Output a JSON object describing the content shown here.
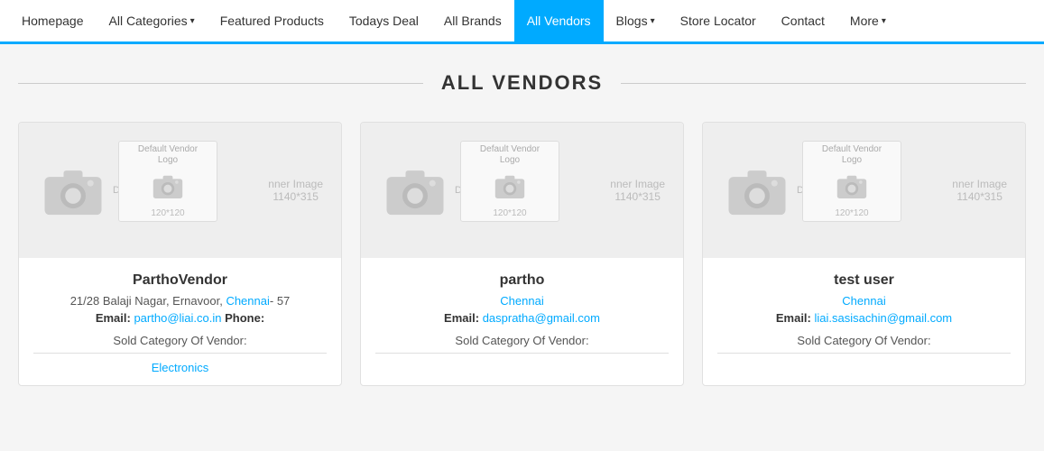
{
  "nav": {
    "items": [
      {
        "label": "Homepage",
        "active": false,
        "hasDropdown": false
      },
      {
        "label": "All Categories",
        "active": false,
        "hasDropdown": true
      },
      {
        "label": "Featured Products",
        "active": false,
        "hasDropdown": false
      },
      {
        "label": "Todays Deal",
        "active": false,
        "hasDropdown": false
      },
      {
        "label": "All Brands",
        "active": false,
        "hasDropdown": false
      },
      {
        "label": "All Vendors",
        "active": true,
        "hasDropdown": false
      },
      {
        "label": "Blogs",
        "active": false,
        "hasDropdown": true
      },
      {
        "label": "Store Locator",
        "active": false,
        "hasDropdown": false
      },
      {
        "label": "Contact",
        "active": false,
        "hasDropdown": false
      },
      {
        "label": "More",
        "active": false,
        "hasDropdown": true
      }
    ]
  },
  "page": {
    "title": "ALL VENDORS"
  },
  "vendors": [
    {
      "name": "ParthoVendor",
      "address": "21/28 Balaji Nagar, Ernavoor, Chennai- 57",
      "address_link": "Chennai",
      "email_label": "Email:",
      "email": "partho@liai.co.in",
      "phone_label": "Phone:",
      "phone": "",
      "sold_category_label": "Sold Category Of Vendor:",
      "sold_category": "Electronics",
      "logo_label": "Default Vendor\nLogo",
      "logo_size": "120*120",
      "banner_text": "nner Image",
      "banner_size": "1140*315"
    },
    {
      "name": "partho",
      "address": "",
      "address_link": "Chennai",
      "email_label": "Email:",
      "email": "daspratha@gmail.com",
      "phone_label": "",
      "phone": "",
      "sold_category_label": "Sold Category Of Vendor:",
      "sold_category": "",
      "logo_label": "Default Vendor\nLogo",
      "logo_size": "120*120",
      "banner_text": "nner Image",
      "banner_size": "1140*315"
    },
    {
      "name": "test user",
      "address": "",
      "address_link": "Chennai",
      "email_label": "Email:",
      "email": "liai.sasisachin@gmail.com",
      "phone_label": "",
      "phone": "",
      "sold_category_label": "Sold Category Of Vendor:",
      "sold_category": "",
      "logo_label": "Default Vendor\nLogo",
      "logo_size": "120*120",
      "banner_text": "nner Image",
      "banner_size": "1140*315"
    }
  ]
}
